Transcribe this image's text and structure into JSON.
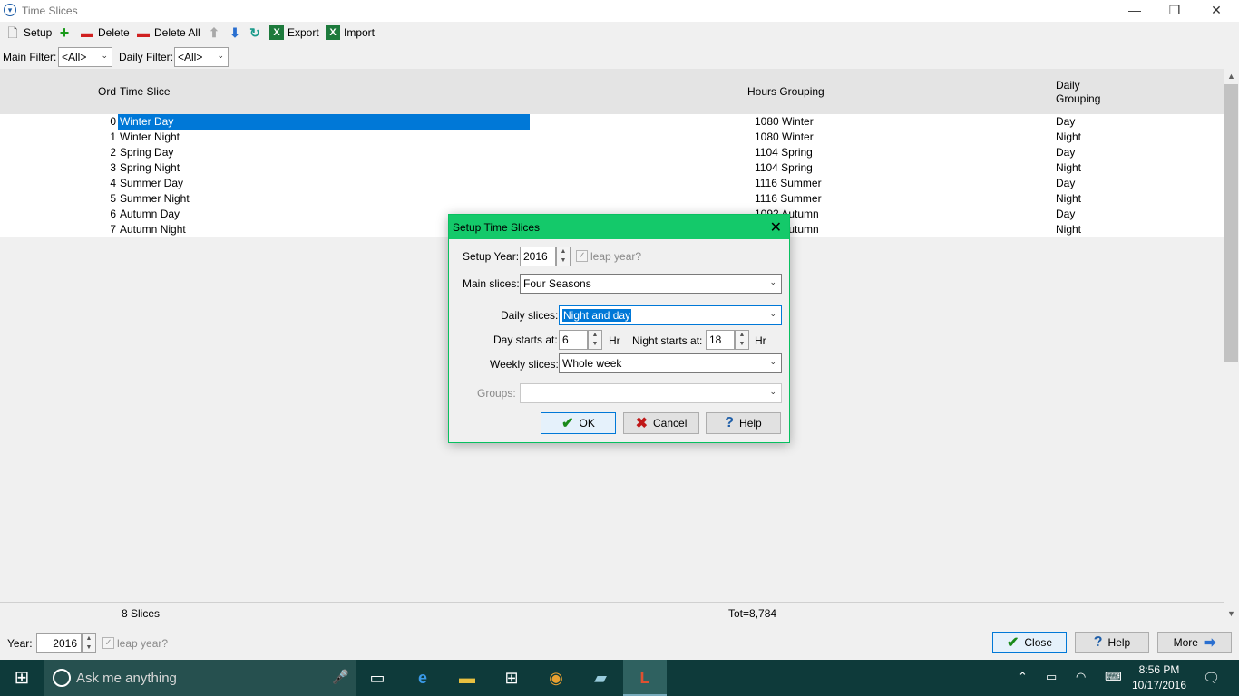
{
  "window": {
    "title": "Time Slices",
    "minimize": "—",
    "restore": "❐",
    "close": "✕"
  },
  "toolbar": {
    "setup": "Setup",
    "delete": "Delete",
    "delete_all": "Delete All",
    "export": "Export",
    "import": "Import"
  },
  "filters": {
    "main_label": "Main Filter:",
    "main_value": "<All>",
    "daily_label": "Daily Filter:",
    "daily_value": "<All>"
  },
  "grid": {
    "headers": {
      "ord": "Ord",
      "time_slice": "Time Slice",
      "hours_grouping": "Hours Grouping",
      "daily_grouping_1": "Daily",
      "daily_grouping_2": "Grouping"
    },
    "rows": [
      {
        "ord": "0",
        "time_slice": "Winter Day",
        "hours": "1080 Winter",
        "daily": "Day"
      },
      {
        "ord": "1",
        "time_slice": "Winter Night",
        "hours": "1080 Winter",
        "daily": "Night"
      },
      {
        "ord": "2",
        "time_slice": "Spring Day",
        "hours": "1104 Spring",
        "daily": "Day"
      },
      {
        "ord": "3",
        "time_slice": "Spring Night",
        "hours": "1104 Spring",
        "daily": "Night"
      },
      {
        "ord": "4",
        "time_slice": "Summer Day",
        "hours": "1116 Summer",
        "daily": "Day"
      },
      {
        "ord": "5",
        "time_slice": "Summer Night",
        "hours": "1116 Summer",
        "daily": "Night"
      },
      {
        "ord": "6",
        "time_slice": "Autumn Day",
        "hours": "1092 Autumn",
        "daily": "Day"
      },
      {
        "ord": "7",
        "time_slice": "Autumn Night",
        "hours": "1092 Autumn",
        "daily": "Night"
      }
    ],
    "footer_count": "8 Slices",
    "footer_total": "Tot=8,784"
  },
  "bottom": {
    "year_label": "Year:",
    "year_value": "2016",
    "leap_label": "leap year?",
    "close": "Close",
    "help": "Help",
    "more": "More"
  },
  "dialog": {
    "title": "Setup Time Slices",
    "setup_year_label": "Setup Year:",
    "setup_year_value": "2016",
    "leap_label": "leap year?",
    "main_slices_label": "Main slices:",
    "main_slices_value": "Four Seasons",
    "daily_slices_label": "Daily slices:",
    "daily_slices_value": "Night and day",
    "day_starts_label": "Day starts at:",
    "day_starts_value": "6",
    "hr1": "Hr",
    "night_starts_label": "Night starts at:",
    "night_starts_value": "18",
    "hr2": "Hr",
    "weekly_slices_label": "Weekly slices:",
    "weekly_slices_value": "Whole week",
    "groups_label": "Groups:",
    "groups_value": "",
    "ok": "OK",
    "cancel": "Cancel",
    "help": "Help"
  },
  "taskbar": {
    "search_placeholder": "Ask me anything",
    "time": "8:56 PM",
    "date": "10/17/2016"
  },
  "colors": {
    "selection": "#0078d7",
    "dialog_title": "#14c96a",
    "taskbar": "#0e3a3a"
  }
}
